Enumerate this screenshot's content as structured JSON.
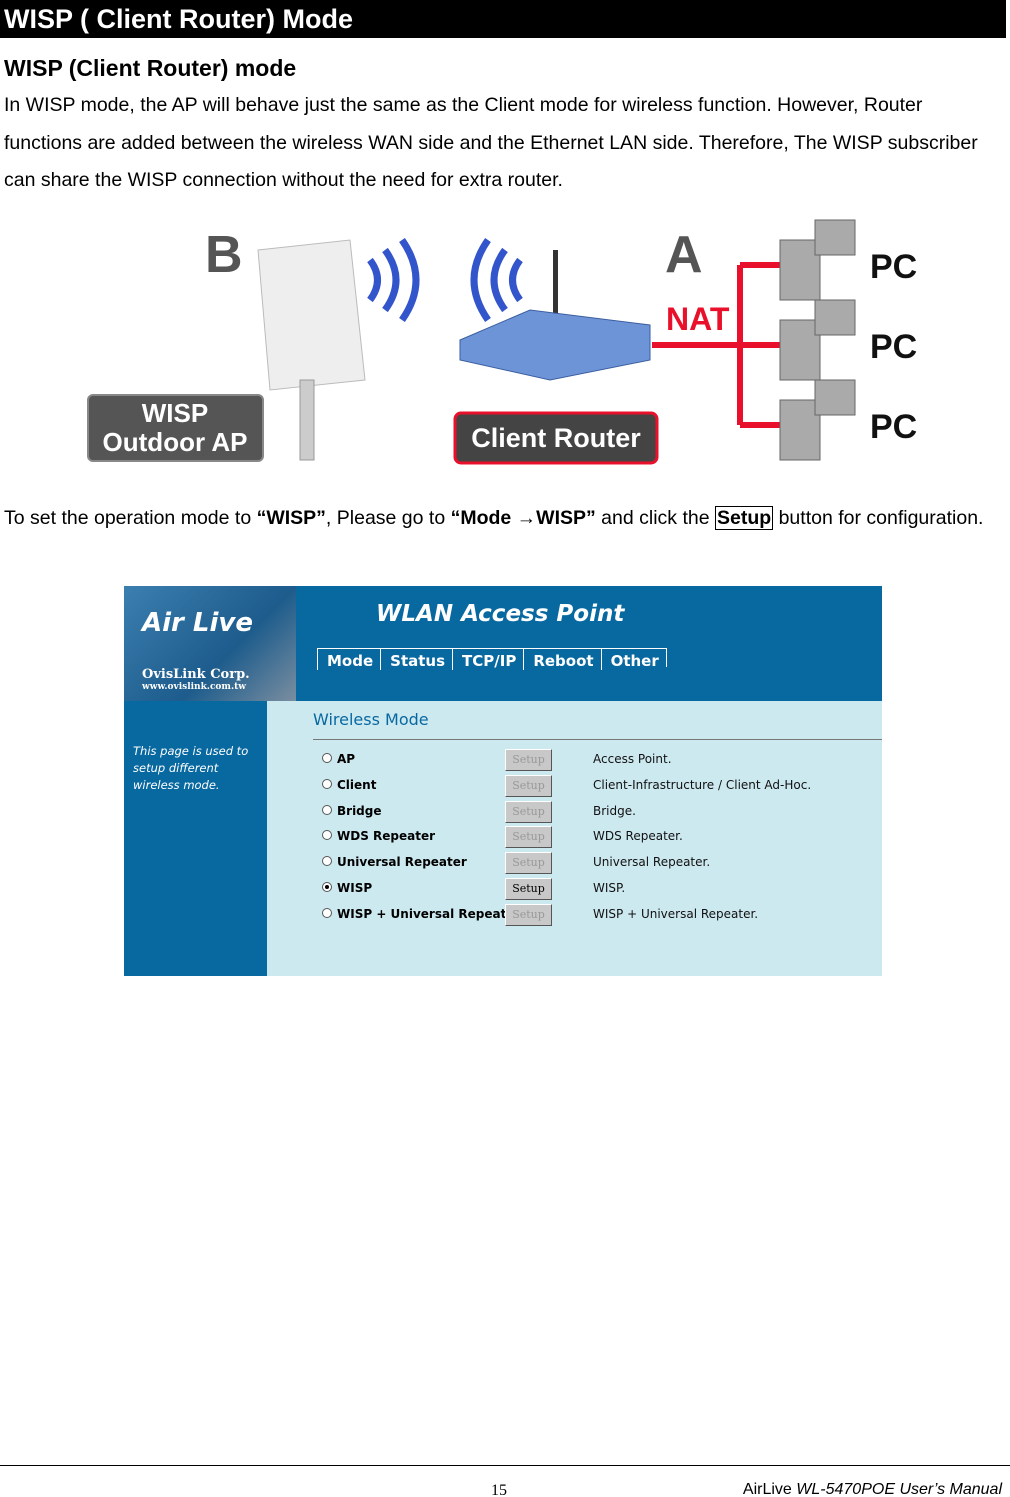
{
  "header": {
    "title": "WISP ( Client Router) Mode"
  },
  "section": {
    "heading": "WISP (Client Router) mode",
    "intro": "In WISP mode, the AP will behave just the same as the Client mode for wireless function. However, Router functions are added between the wireless WAN side and the Ethernet LAN side. Therefore, The WISP subscriber can share the WISP connection without the need for extra router."
  },
  "diagram": {
    "label_b": "B",
    "label_a": "A",
    "nat": "NAT",
    "pc": [
      "PC",
      "PC",
      "PC"
    ],
    "wisp_ap": [
      "WISP",
      "Outdoor AP"
    ],
    "client_router": "Client Router",
    "colors": {
      "nat_line": "#e8102a",
      "label_box": "#555555",
      "router_box": "#e8102a"
    }
  },
  "instruction": {
    "t1": "To set the operation mode to ",
    "b1": "“WISP”",
    "t2": ", Please go to ",
    "b2": "“Mode →WISP”",
    "t3": " and click the ",
    "button": "Setup",
    "t4": " button for configuration."
  },
  "screenshot": {
    "logo": {
      "brand": "Air Live",
      "company": "OvisLink Corp.",
      "url": "www.ovislink.com.tw"
    },
    "app_title": "WLAN Access Point",
    "nav": [
      "Mode",
      "Status",
      "TCP/IP",
      "Reboot",
      "Other"
    ],
    "sidebar_text": "This page is used to setup different wireless mode.",
    "section_title": "Wireless Mode",
    "setup_label": "Setup",
    "modes": [
      {
        "label": "AP",
        "desc": "Access Point.",
        "selected": false
      },
      {
        "label": "Client",
        "desc": "Client-Infrastructure / Client Ad-Hoc.",
        "selected": false
      },
      {
        "label": "Bridge",
        "desc": "Bridge.",
        "selected": false
      },
      {
        "label": "WDS Repeater",
        "desc": "WDS Repeater.",
        "selected": false
      },
      {
        "label": "Universal Repeater",
        "desc": "Universal Repeater.",
        "selected": false
      },
      {
        "label": "WISP",
        "desc": "WISP.",
        "selected": true
      },
      {
        "label": "WISP + Universal Repeater",
        "desc": "WISP + Universal Repeater.",
        "selected": false
      }
    ],
    "colors": {
      "header": "#0868a0",
      "content": "#cde9f0"
    }
  },
  "footer": {
    "page": "15",
    "brand": "AirLive ",
    "manual": "WL-5470POE User’s Manual"
  }
}
